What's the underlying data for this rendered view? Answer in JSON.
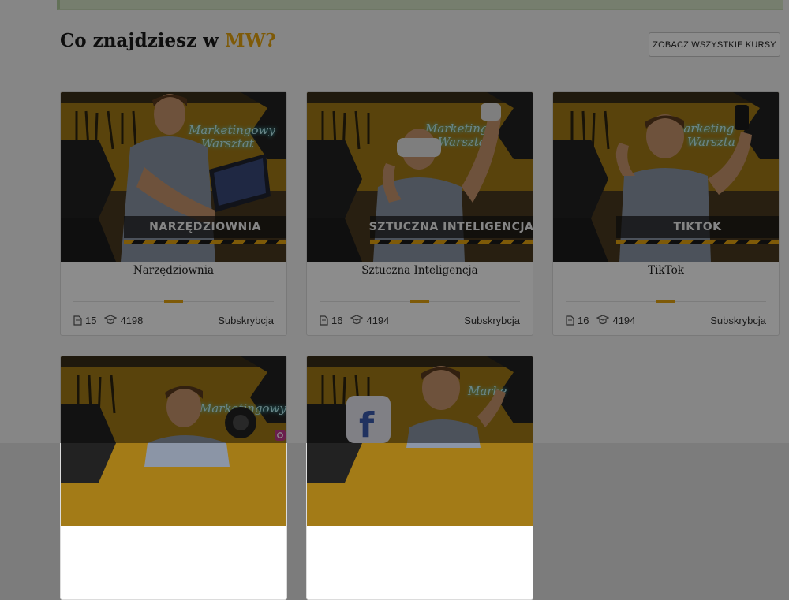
{
  "section": {
    "heading_prefix": "Co znajdziesz w ",
    "heading_accent": "MW?",
    "all_courses_label": "ZOBACZ WSZYSTKIE KURSY"
  },
  "colors": {
    "accent": "#e6a50f",
    "overlay": "rgba(0,0,0,0.45)"
  },
  "courses": [
    {
      "banner": "NARZĘDZIOWNIA",
      "title": "Narzędziownia",
      "lessons": "15",
      "students": "4198",
      "access": "Subskrybcja",
      "sign_line1": "Marketingowy",
      "sign_line2": "Warsztat"
    },
    {
      "banner": "SZTUCZNA INTELIGENCJA",
      "title": "Sztuczna Inteligencja",
      "lessons": "16",
      "students": "4194",
      "access": "Subskrybcja",
      "sign_line1": "Marketing",
      "sign_line2": "Warsztat"
    },
    {
      "banner": "TIKTOK",
      "title": "TikTok",
      "lessons": "16",
      "students": "4194",
      "access": "Subskrybcja",
      "sign_line1": "Marketing",
      "sign_line2": "Warszta"
    },
    {
      "sign_line1": "Marketingowy"
    },
    {
      "sign_line1": "Marke"
    }
  ],
  "icons": {
    "lessons": "document-icon",
    "students": "graduation-cap-icon",
    "facebook": "facebook-icon",
    "instagram": "instagram-icon"
  }
}
